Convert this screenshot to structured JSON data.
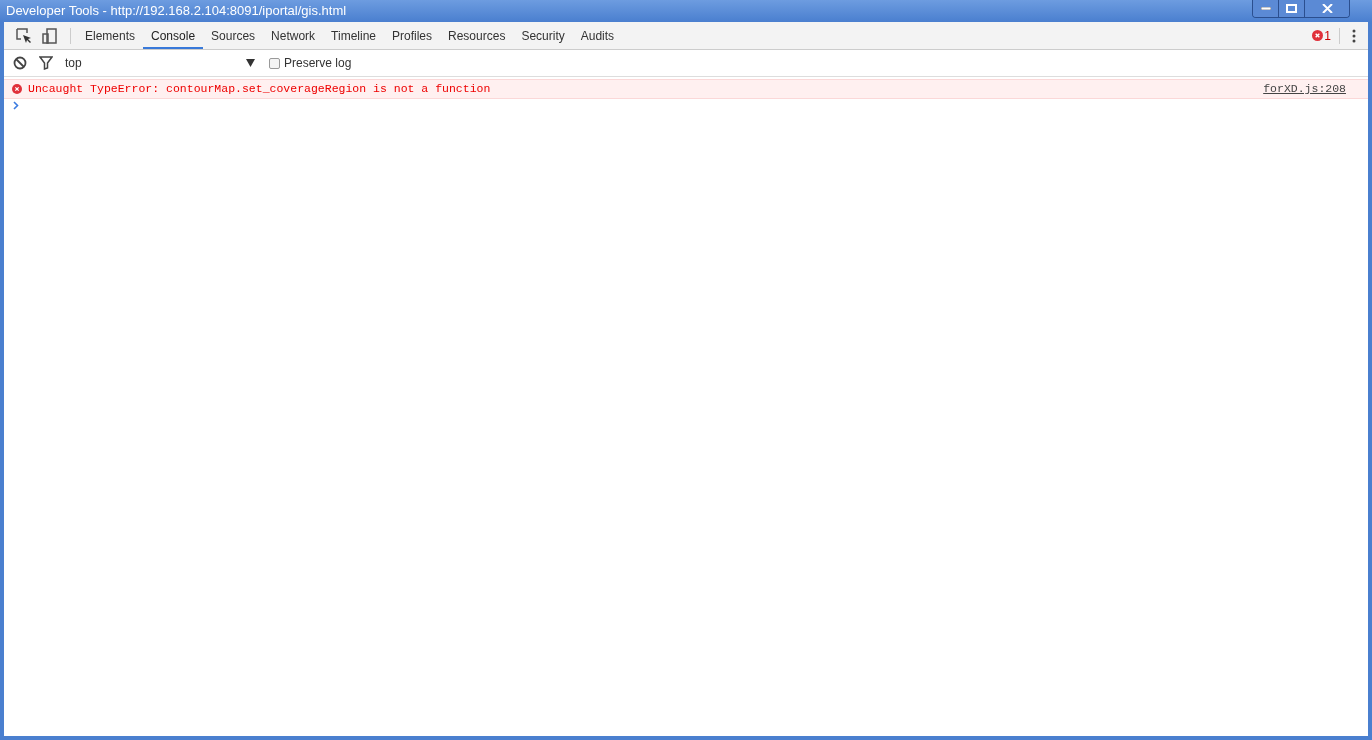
{
  "window": {
    "title": "Developer Tools - http://192.168.2.104:8091/iportal/gis.html"
  },
  "tabs": [
    {
      "label": "Elements",
      "selected": false
    },
    {
      "label": "Console",
      "selected": true
    },
    {
      "label": "Sources",
      "selected": false
    },
    {
      "label": "Network",
      "selected": false
    },
    {
      "label": "Timeline",
      "selected": false
    },
    {
      "label": "Profiles",
      "selected": false
    },
    {
      "label": "Resources",
      "selected": false
    },
    {
      "label": "Security",
      "selected": false
    },
    {
      "label": "Audits",
      "selected": false
    }
  ],
  "error_count": "1",
  "filter_bar": {
    "context": "top",
    "preserve_log": {
      "label": "Preserve log",
      "checked": false
    }
  },
  "messages": [
    {
      "kind": "error",
      "text": "Uncaught TypeError: contourMap.set_coverageRegion is not a function",
      "source": "forXD.js:208"
    }
  ]
}
